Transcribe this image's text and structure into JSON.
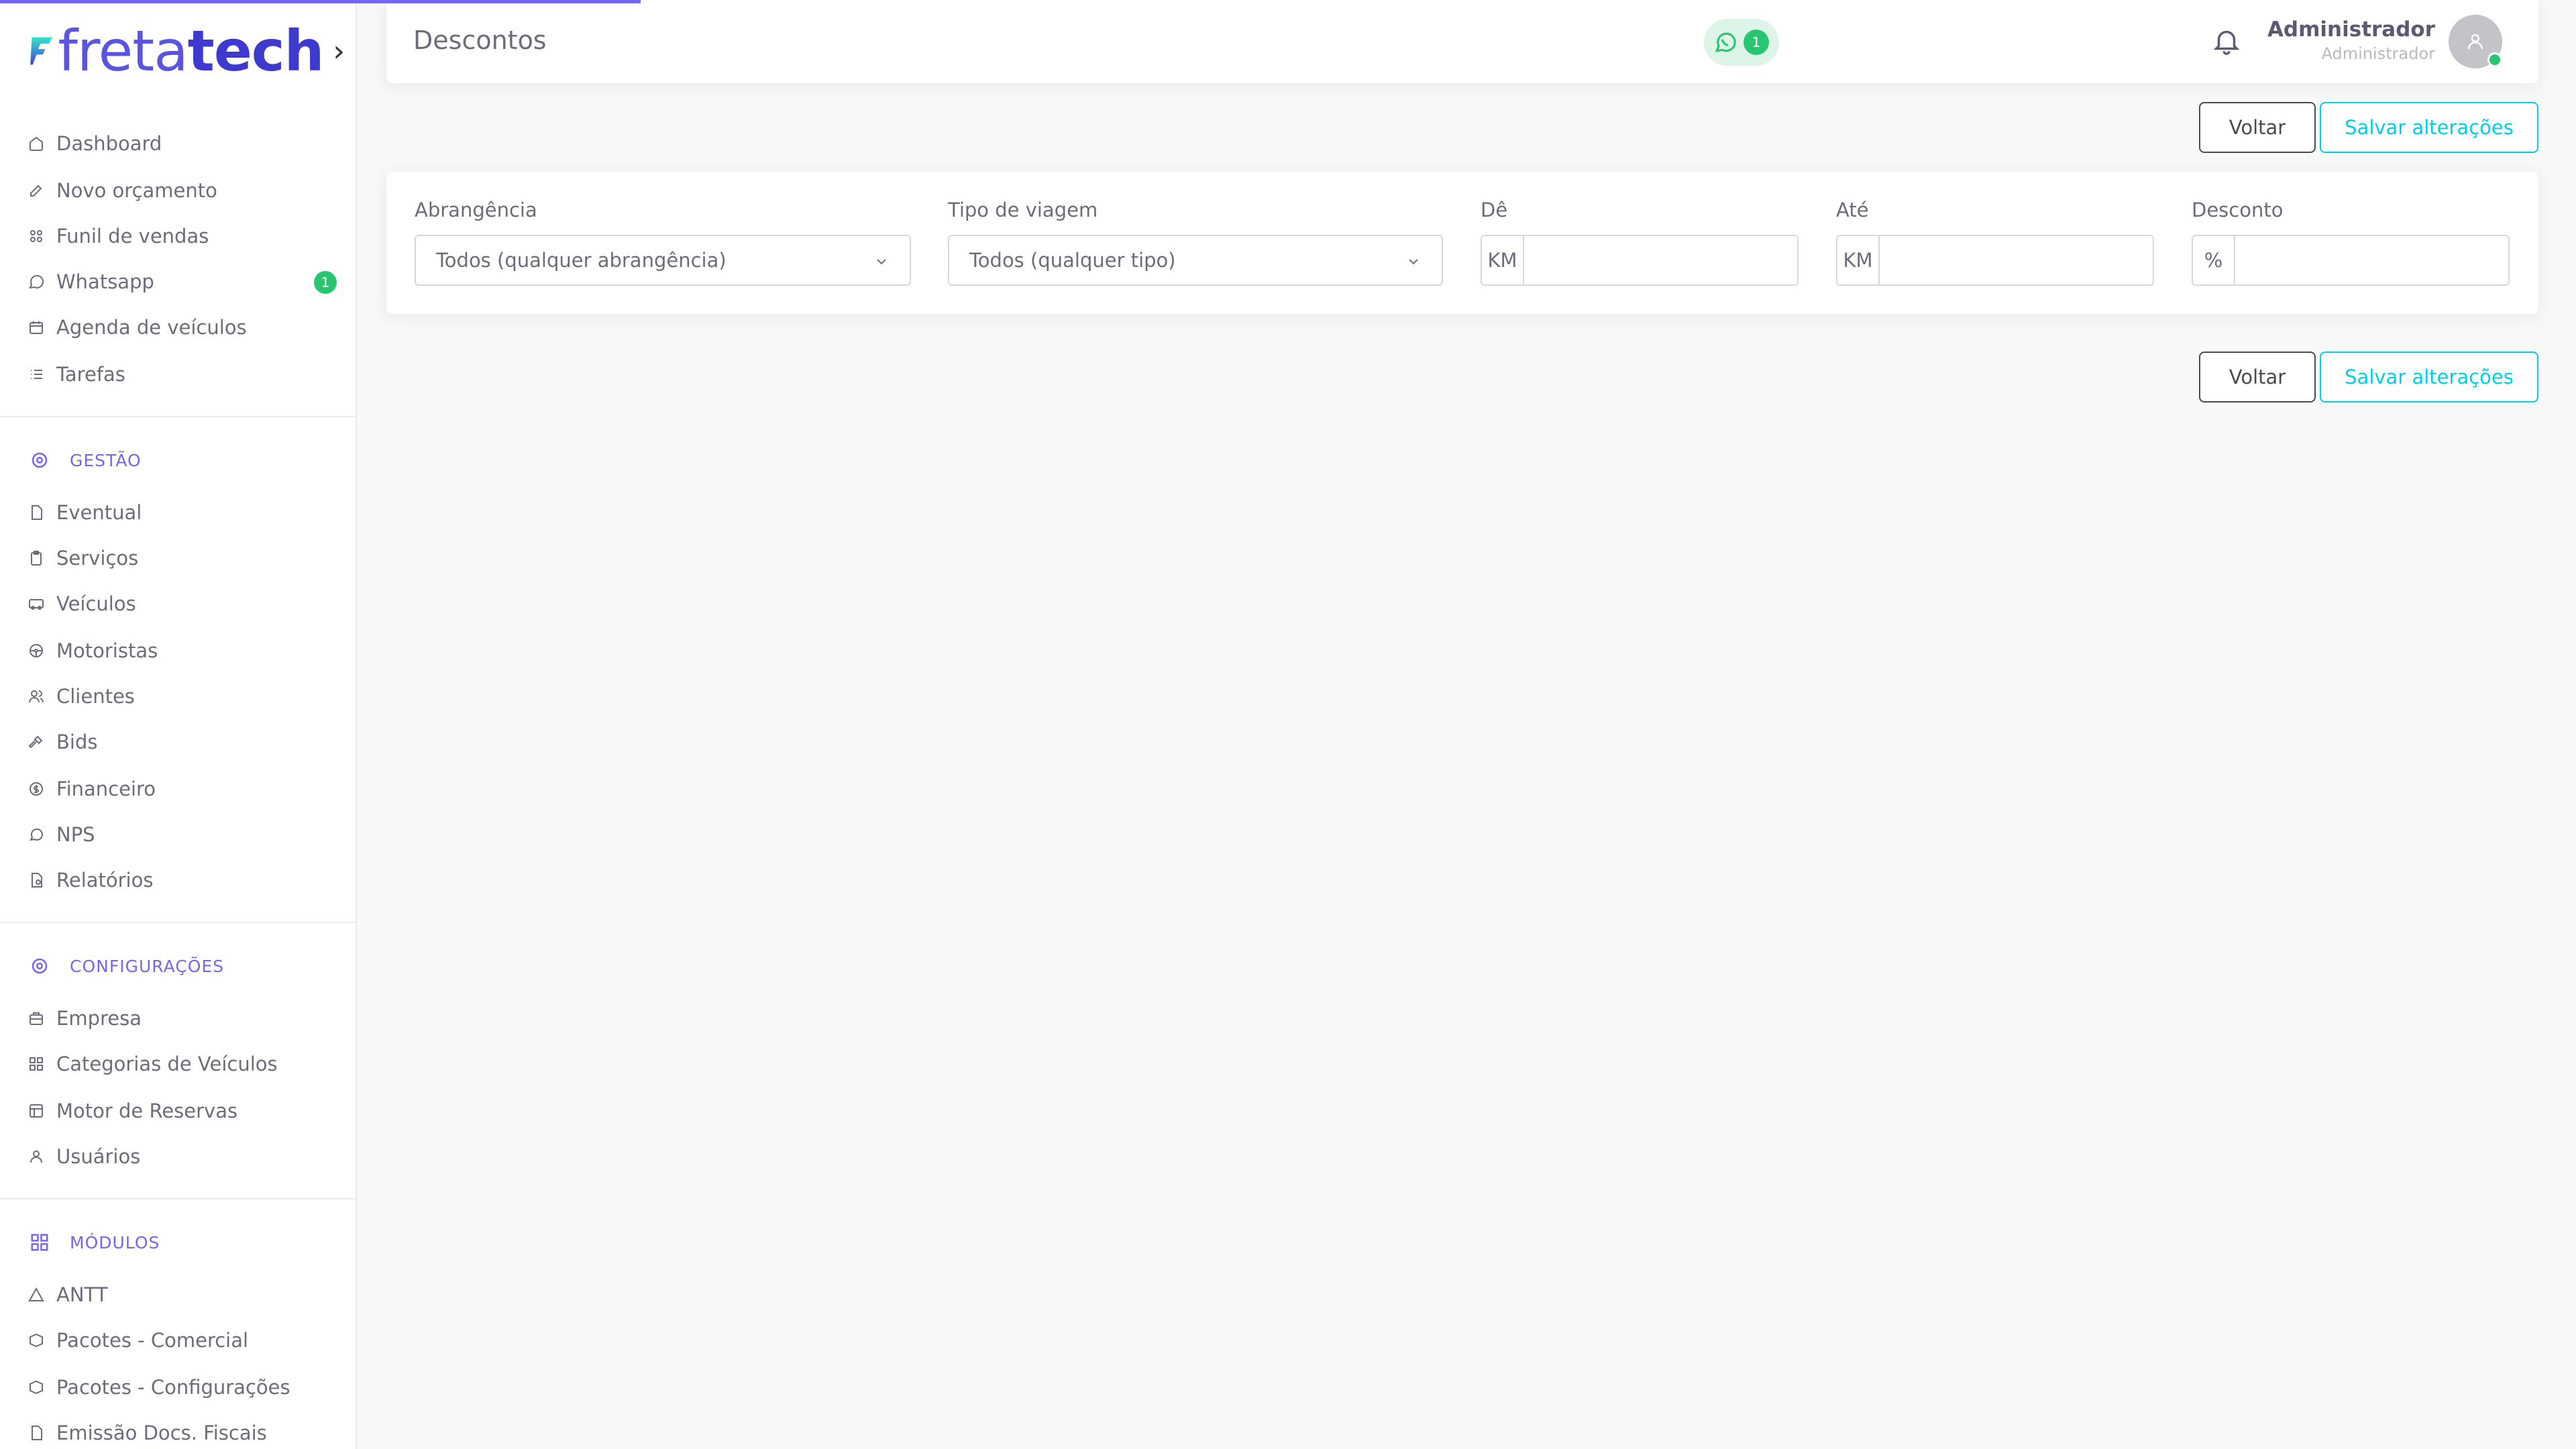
{
  "logo": {
    "part1": "freta",
    "part2": "tech",
    "toggle": "›"
  },
  "sidebar": {
    "main_items": [
      {
        "label": "Dashboard",
        "icon": "home-icon"
      },
      {
        "label": "Novo orçamento",
        "icon": "edit-icon"
      },
      {
        "label": "Funil de vendas",
        "icon": "funnel-icon"
      },
      {
        "label": "Whatsapp",
        "icon": "whatsapp-icon",
        "badge": "1"
      },
      {
        "label": "Agenda de veículos",
        "icon": "calendar-icon"
      },
      {
        "label": "Tarefas",
        "icon": "list-icon"
      }
    ],
    "sections": [
      {
        "title": "GESTÃO",
        "icon": "gear-icon",
        "items": [
          "Eventual",
          "Serviços",
          "Veículos",
          "Motoristas",
          "Clientes",
          "Bids",
          "Financeiro",
          "NPS",
          "Relatórios"
        ]
      },
      {
        "title": "CONFIGURAÇÕES",
        "icon": "gear-icon",
        "items": [
          "Empresa",
          "Categorias de Veículos",
          "Motor de Reservas",
          "Usuários"
        ]
      },
      {
        "title": "MÓDULOS",
        "icon": "grid-icon",
        "items": [
          "ANTT",
          "Pacotes - Comercial",
          "Pacotes - Configurações",
          "Emissão Docs. Fiscais"
        ]
      }
    ]
  },
  "header": {
    "title": "Descontos",
    "whatsapp_count": "1",
    "user_name": "Administrador",
    "user_role": "Administrador"
  },
  "actions": {
    "back_label": "Voltar",
    "save_label": "Salvar alterações"
  },
  "form": {
    "scope": {
      "label": "Abrangência",
      "value": "Todos (qualquer abrangência)"
    },
    "trip_type": {
      "label": "Tipo de viagem",
      "value": "Todos (qualquer tipo)"
    },
    "from": {
      "label": "Dê",
      "addon": "KM",
      "value": ""
    },
    "to": {
      "label": "Até",
      "addon": "KM",
      "value": ""
    },
    "discount": {
      "label": "Desconto",
      "addon": "%",
      "value": ""
    }
  },
  "colors": {
    "primary": "#7367f0",
    "success": "#28c76f",
    "info": "#00cfe8"
  }
}
